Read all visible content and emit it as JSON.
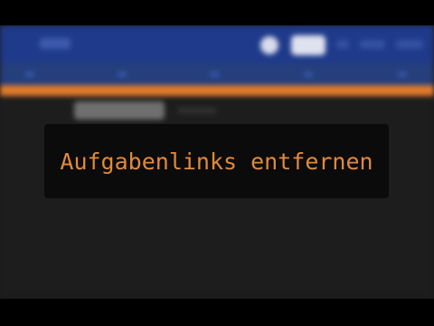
{
  "caption": {
    "text": "Aufgabenlinks entfernen"
  },
  "colors": {
    "topbar": "#1f3a8a",
    "accent": "#e07a2b",
    "caption_text": "#e08a3c",
    "caption_background": "#0b0b0b",
    "app_background": "#1d1d1d"
  },
  "icons": [
    "profile-circle-icon"
  ]
}
